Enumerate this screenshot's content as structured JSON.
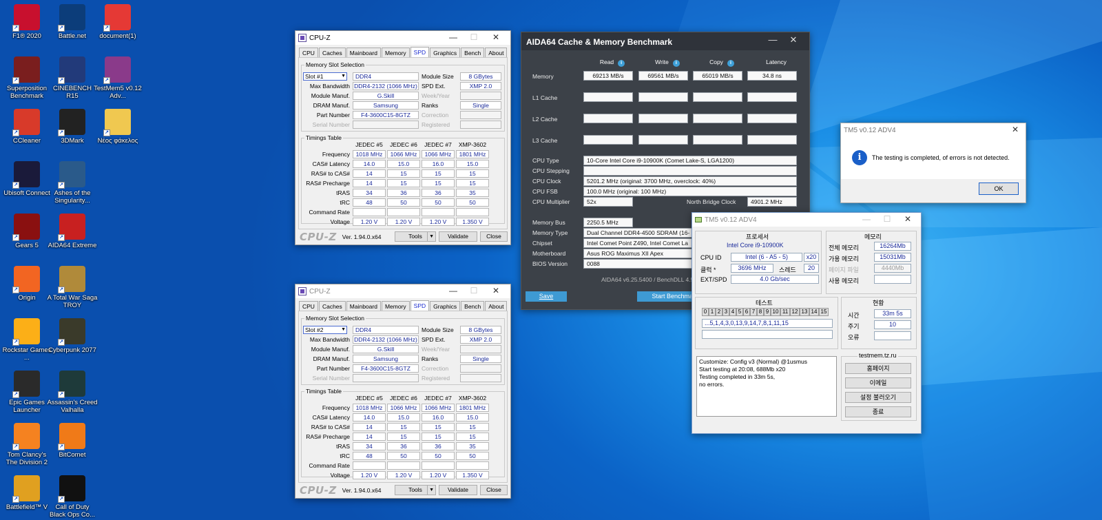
{
  "desktop_icons": [
    {
      "label": "F1® 2020",
      "icon": "f1-icon",
      "color": "#c8102e"
    },
    {
      "label": "Battle.net",
      "icon": "battlenet-icon",
      "color": "#0c3d7a"
    },
    {
      "label": "document(1)",
      "icon": "pdf-icon",
      "color": "#e53935"
    },
    {
      "label": "Superposition Benchmark",
      "icon": "superposition-icon",
      "color": "#7a1e1e"
    },
    {
      "label": "CINEBENCH R15",
      "icon": "cinebench-icon",
      "color": "#223a7a"
    },
    {
      "label": "TestMem5 v0.12 Adv...",
      "icon": "winrar-icon",
      "color": "#8a3a8a"
    },
    {
      "label": "CCleaner",
      "icon": "ccleaner-icon",
      "color": "#d83a2a"
    },
    {
      "label": "3DMark",
      "icon": "3dmark-icon",
      "color": "#222"
    },
    {
      "label": "Νέος φάκελος",
      "icon": "folder-icon",
      "color": "#f0c850"
    },
    {
      "label": "Ubisoft Connect",
      "icon": "ubisoft-icon",
      "color": "#1a1a3a"
    },
    {
      "label": "Ashes of the Singularity...",
      "icon": "ashes-icon",
      "color": "#2a5a8a"
    },
    {
      "label": "Gears 5",
      "icon": "gears-icon",
      "color": "#8a1010"
    },
    {
      "label": "AIDA64 Extreme",
      "icon": "aida64-icon",
      "color": "#c82020"
    },
    {
      "label": "Origin",
      "icon": "origin-icon",
      "color": "#f26522"
    },
    {
      "label": "A Total War Saga TROY",
      "icon": "troy-icon",
      "color": "#b08a3a"
    },
    {
      "label": "Rockstar Games ...",
      "icon": "rockstar-icon",
      "color": "#fcaf17"
    },
    {
      "label": "Cyberpunk 2077",
      "icon": "cyberpunk-icon",
      "color": "#3a3a2a"
    },
    {
      "label": "Epic Games Launcher",
      "icon": "epic-icon",
      "color": "#2a2a2a"
    },
    {
      "label": "Assassin's Creed Valhalla",
      "icon": "valhalla-icon",
      "color": "#1e3a3a"
    },
    {
      "label": "Tom Clancy's The Division 2",
      "icon": "division-icon",
      "color": "#f58220"
    },
    {
      "label": "BitComet",
      "icon": "bitcomet-icon",
      "color": "#f07a18"
    },
    {
      "label": "Battlefield™ V",
      "icon": "battlefield-icon",
      "color": "#e0a020"
    },
    {
      "label": "Call of Duty Black Ops Co...",
      "icon": "cod-icon",
      "color": "#111"
    }
  ],
  "cpuz": {
    "title": "CPU-Z",
    "tabs": [
      "CPU",
      "Caches",
      "Mainboard",
      "Memory",
      "SPD",
      "Graphics",
      "Bench",
      "About"
    ],
    "active_tab": "SPD",
    "slot_group": "Memory Slot Selection",
    "slot_labels": {
      "max_bw": "Max Bandwidth",
      "manuf": "Module Manuf.",
      "dram": "DRAM Manuf.",
      "part": "Part Number",
      "serial": "Serial Number",
      "size": "Module Size",
      "spd": "SPD Ext.",
      "week": "Week/Year",
      "ranks": "Ranks",
      "corr": "Correction",
      "reg": "Registered"
    },
    "timings_group": "Timings Table",
    "timing_cols": [
      "JEDEC #5",
      "JEDEC #6",
      "JEDEC #7",
      "XMP-3602"
    ],
    "timing_rows": [
      {
        "label": "Frequency",
        "vals": [
          "1018 MHz",
          "1066 MHz",
          "1066 MHz",
          "1801 MHz"
        ]
      },
      {
        "label": "CAS# Latency",
        "vals": [
          "14.0",
          "15.0",
          "16.0",
          "15.0"
        ]
      },
      {
        "label": "RAS# to CAS#",
        "vals": [
          "14",
          "15",
          "15",
          "15"
        ]
      },
      {
        "label": "RAS# Precharge",
        "vals": [
          "14",
          "15",
          "15",
          "15"
        ]
      },
      {
        "label": "tRAS",
        "vals": [
          "34",
          "36",
          "36",
          "35"
        ]
      },
      {
        "label": "tRC",
        "vals": [
          "48",
          "50",
          "50",
          "50"
        ]
      },
      {
        "label": "Command Rate",
        "vals": [
          "",
          "",
          "",
          ""
        ]
      },
      {
        "label": "Voltage",
        "vals": [
          "1.20 V",
          "1.20 V",
          "1.20 V",
          "1.350 V"
        ]
      }
    ],
    "logo": "CPU-Z",
    "version": "Ver. 1.94.0.x64",
    "tools": "Tools",
    "validate": "Validate",
    "close": "Close",
    "windows": [
      {
        "slot": "Slot #1",
        "type": "DDR4",
        "max_bw": "DDR4-2132 (1066 MHz)",
        "manuf": "G.Skill",
        "dram": "Samsung",
        "part": "F4-3600C15-8GTZ",
        "size": "8 GBytes",
        "spd": "XMP 2.0",
        "ranks": "Single"
      },
      {
        "slot": "Slot #2",
        "type": "DDR4",
        "max_bw": "DDR4-2132 (1066 MHz)",
        "manuf": "G.Skill",
        "dram": "Samsung",
        "part": "F4-3600C15-8GTZ",
        "size": "8 GBytes",
        "spd": "XMP 2.0",
        "ranks": "Single"
      }
    ]
  },
  "aida": {
    "title": "AIDA64 Cache & Memory Benchmark",
    "cols": [
      "Read",
      "Write",
      "Copy",
      "Latency"
    ],
    "rows": [
      "Memory",
      "L1 Cache",
      "L2 Cache",
      "L3 Cache"
    ],
    "memory": [
      "69213 MB/s",
      "69561 MB/s",
      "65019 MB/s",
      "34.8 ns"
    ],
    "info_labels": [
      "CPU Type",
      "CPU Stepping",
      "CPU Clock",
      "CPU FSB",
      "CPU Multiplier"
    ],
    "cpu_type": "10-Core Intel Core i9-10900K  (Comet Lake-S, LGA1200)",
    "cpu_stepping": "",
    "cpu_clock": "5201.2 MHz  (original: 3700 MHz, overclock: 40%)",
    "cpu_fsb": "100.0 MHz  (original: 100 MHz)",
    "cpu_mult": "52x",
    "nb_label": "North Bridge Clock",
    "nb_clock": "4901.2 MHz",
    "mem_labels": [
      "Memory Bus",
      "Memory Type",
      "Chipset",
      "Motherboard",
      "BIOS Version"
    ],
    "mem_bus": "2250.5 MHz",
    "mem_type": "Dual Channel DDR4-4500 SDRAM  (16-",
    "chipset": "Intel Comet Point Z490, Intel Comet La",
    "motherboard": "Asus ROG Maximus XII Apex",
    "bios": "0088",
    "footer": "AIDA64 v6.25.5400 / BenchDLL 4.5",
    "save": "Save",
    "start": "Start Benchmark"
  },
  "tm5_dialog": {
    "title": "TM5 v0.12 ADV4",
    "message": "The testing is completed, of errors is not detected.",
    "ok": "OK"
  },
  "tm5": {
    "title": "TM5 v0.12 ADV4",
    "proc_hd": "프로세서",
    "cpu_name": "Intel Core i9-10900K",
    "cpuid_lbl": "CPU ID",
    "cpuid": "Intel  (6 - A5 - 5)",
    "threads_x": "x20",
    "clock_lbl": "클럭 *",
    "clock": "3696 MHz",
    "thread_lbl": "스레드",
    "threads": "20",
    "ext_lbl": "EXT/SPD",
    "ext": "4.0 Gb/sec",
    "mem_hd": "메모리",
    "mem_rows": [
      {
        "label": "전체 메모리",
        "value": "16264Mb",
        "gray": false
      },
      {
        "label": "가용 메모리",
        "value": "15031Mb",
        "gray": false
      },
      {
        "label": "페이지 파일",
        "value": "4440Mb",
        "gray": true
      },
      {
        "label": "사용 메모리",
        "value": "",
        "gray": false
      }
    ],
    "test_hd": "테스트",
    "cells": [
      "0",
      "1",
      "2",
      "3",
      "4",
      "5",
      "6",
      "7",
      "8",
      "9",
      "10",
      "11",
      "12",
      "13",
      "14",
      "15"
    ],
    "sequence": "...5,1,4,3,0,13,9,14,7,8,1,11,15",
    "status_hd": "현황",
    "time_lbl": "시간",
    "time": "33m 5s",
    "cycle_lbl": "주기",
    "cycle": "10",
    "err_lbl": "오류",
    "errors": "",
    "log": [
      "Customize: Config v3 (Normal) @1usmus",
      "Start testing at 20:08, 688Mb x20",
      "Testing completed in 33m 5s,",
      "no errors."
    ],
    "site": "testmem.tz.ru",
    "buttons": [
      "홈페이지",
      "이메일",
      "설정 불러오기",
      "종료"
    ]
  }
}
